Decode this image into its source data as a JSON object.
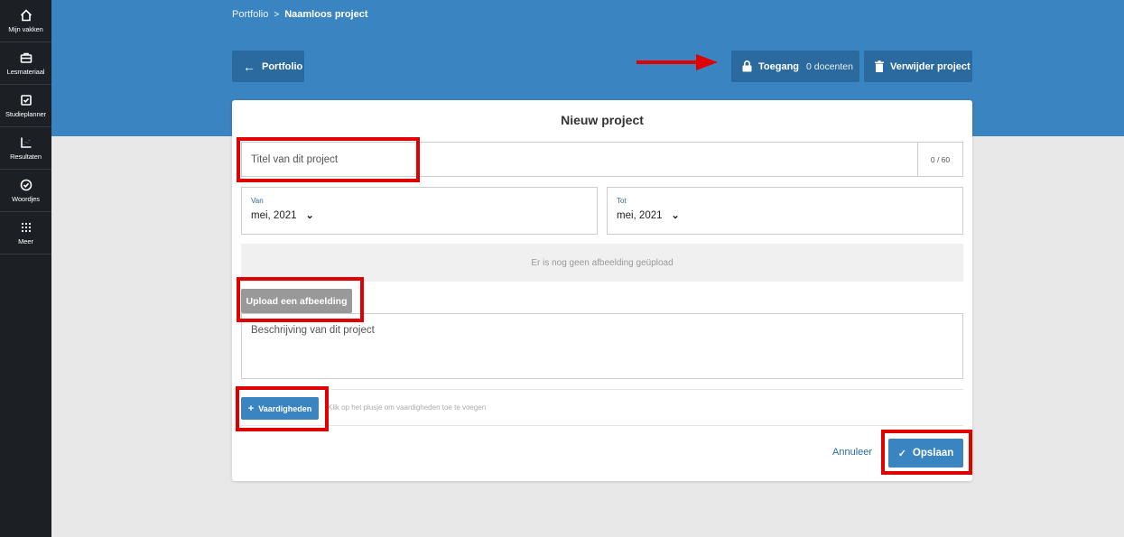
{
  "sidebar": {
    "items": [
      {
        "label": "Mijn vakken",
        "icon": "home-icon"
      },
      {
        "label": "Lesmateriaal",
        "icon": "briefcase-icon"
      },
      {
        "label": "Studieplanner",
        "icon": "calendar-check-icon"
      },
      {
        "label": "Resultaten",
        "icon": "chart-icon"
      },
      {
        "label": "Woordjes",
        "icon": "check-circle-icon"
      },
      {
        "label": "Meer",
        "icon": "grid-icon"
      }
    ]
  },
  "breadcrumb": {
    "parent": "Portfolio",
    "separator": ">",
    "current": "Naamloos project"
  },
  "header": {
    "back_label": "Portfolio",
    "access_label": "Toegang",
    "access_count": "0 docenten",
    "delete_label": "Verwijder project"
  },
  "form": {
    "title": "Nieuw project",
    "title_placeholder": "Titel van dit project",
    "title_counter": "0 / 60",
    "from_label": "Van",
    "from_value": "mei, 2021",
    "to_label": "Tot",
    "to_value": "mei, 2021",
    "no_image_text": "Er is nog geen afbeelding geüpload",
    "upload_label": "Upload een afbeelding",
    "description_placeholder": "Beschrijving van dit project",
    "skills_label": "Vaardigheden",
    "skills_hint": "Klik op het plusje om vaardigheden toe te voegen",
    "cancel_label": "Annuleer",
    "save_label": "Opslaan"
  },
  "colors": {
    "header_blue": "#3a85c1",
    "dark_button": "#2a6a9e",
    "sidebar": "#1c1f24",
    "annotation_red": "#e00000"
  }
}
